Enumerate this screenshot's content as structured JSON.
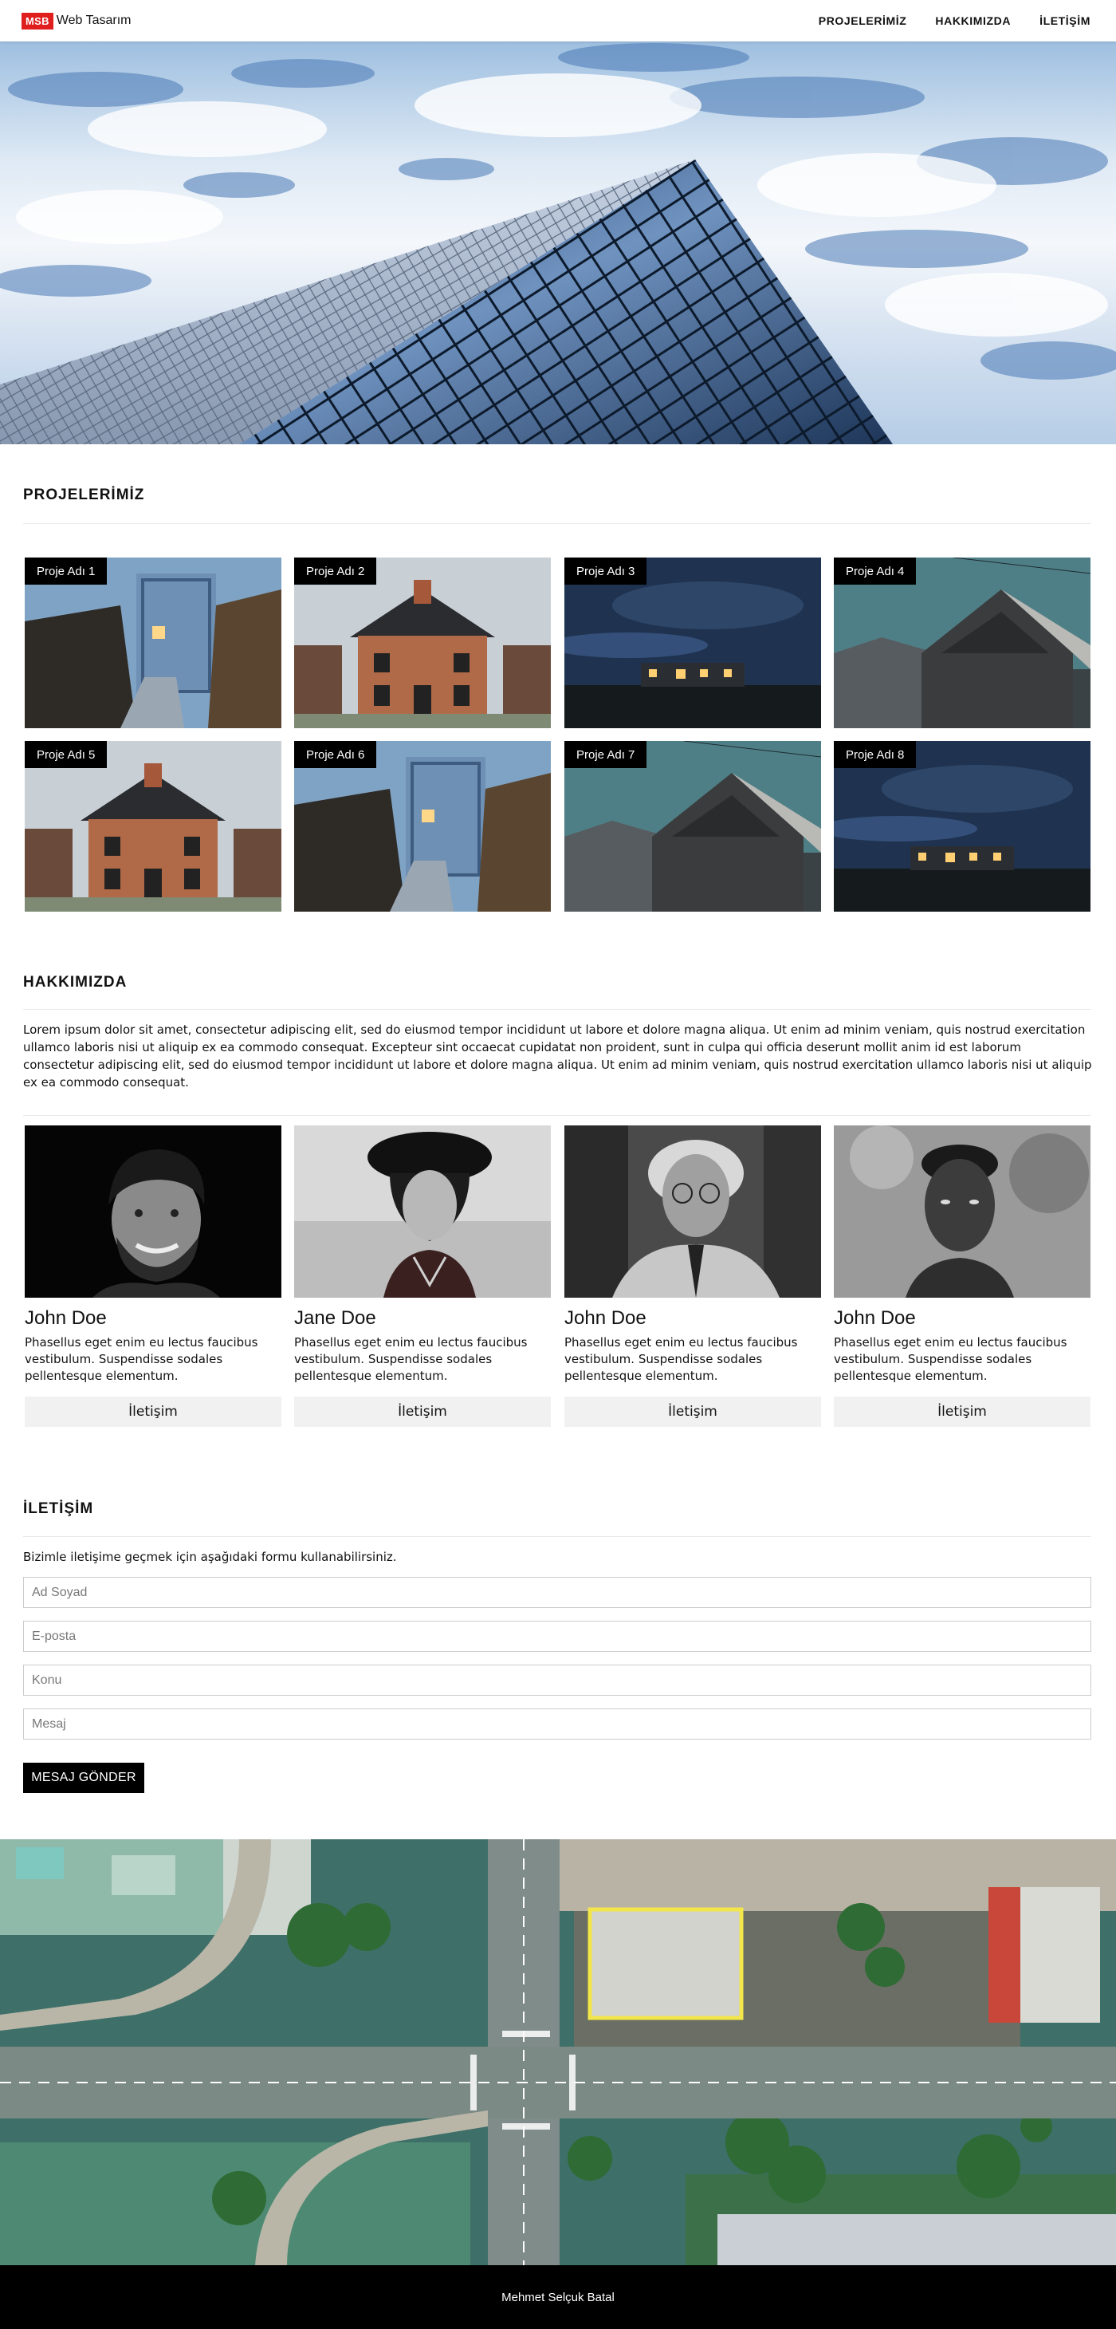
{
  "nav": {
    "badge": "MSB",
    "brand": "Web Tasarım",
    "links": [
      "PROJELERİMİZ",
      "HAKKIMIZDA",
      "İLETİŞİM"
    ]
  },
  "projects": {
    "title": "PROJELERİMİZ",
    "items": [
      {
        "label": "Proje Adı 1",
        "image": "path-house"
      },
      {
        "label": "Proje Adı 2",
        "image": "brick-house"
      },
      {
        "label": "Proje Adı 3",
        "image": "night-house"
      },
      {
        "label": "Proje Adı 4",
        "image": "modern-barn"
      },
      {
        "label": "Proje Adı 5",
        "image": "brick-house"
      },
      {
        "label": "Proje Adı 6",
        "image": "path-house"
      },
      {
        "label": "Proje Adı 7",
        "image": "modern-barn"
      },
      {
        "label": "Proje Adı 8",
        "image": "night-house"
      }
    ]
  },
  "about": {
    "title": "HAKKIMIZDA",
    "text": "Lorem ipsum dolor sit amet, consectetur adipiscing elit, sed do eiusmod tempor incididunt ut labore et dolore magna aliqua. Ut enim ad minim veniam, quis nostrud exercitation ullamco laboris nisi ut aliquip ex ea commodo consequat. Excepteur sint occaecat cupidatat non proident, sunt in culpa qui officia deserunt mollit anim id est laborum consectetur adipiscing elit, sed do eiusmod tempor incididunt ut labore et dolore magna aliqua. Ut enim ad minim veniam, quis nostrud exercitation ullamco laboris nisi ut aliquip ex ea commodo consequat.",
    "team": [
      {
        "name": "John Doe",
        "desc": "Phasellus eget enim eu lectus faucibus vestibulum. Suspendisse sodales pellentesque elementum.",
        "button": "İletişim"
      },
      {
        "name": "Jane Doe",
        "desc": "Phasellus eget enim eu lectus faucibus vestibulum. Suspendisse sodales pellentesque elementum.",
        "button": "İletişim"
      },
      {
        "name": "John Doe",
        "desc": "Phasellus eget enim eu lectus faucibus vestibulum. Suspendisse sodales pellentesque elementum.",
        "button": "İletişim"
      },
      {
        "name": "John Doe",
        "desc": "Phasellus eget enim eu lectus faucibus vestibulum. Suspendisse sodales pellentesque elementum.",
        "button": "İletişim"
      }
    ]
  },
  "contact": {
    "title": "İLETİŞİM",
    "intro": "Bizimle iletişime geçmek için aşağıdaki formu kullanabilirsiniz.",
    "fields": {
      "name_placeholder": "Ad Soyad",
      "email_placeholder": "E-posta",
      "subject_placeholder": "Konu",
      "message_placeholder": "Mesaj"
    },
    "submit": "MESAJ GÖNDER"
  },
  "footer": {
    "text": "Mehmet Selçuk Batal"
  },
  "colors": {
    "brand_badge": "#e01e1e",
    "footer_bg": "#000000",
    "button_bg": "#f1f1f1"
  }
}
